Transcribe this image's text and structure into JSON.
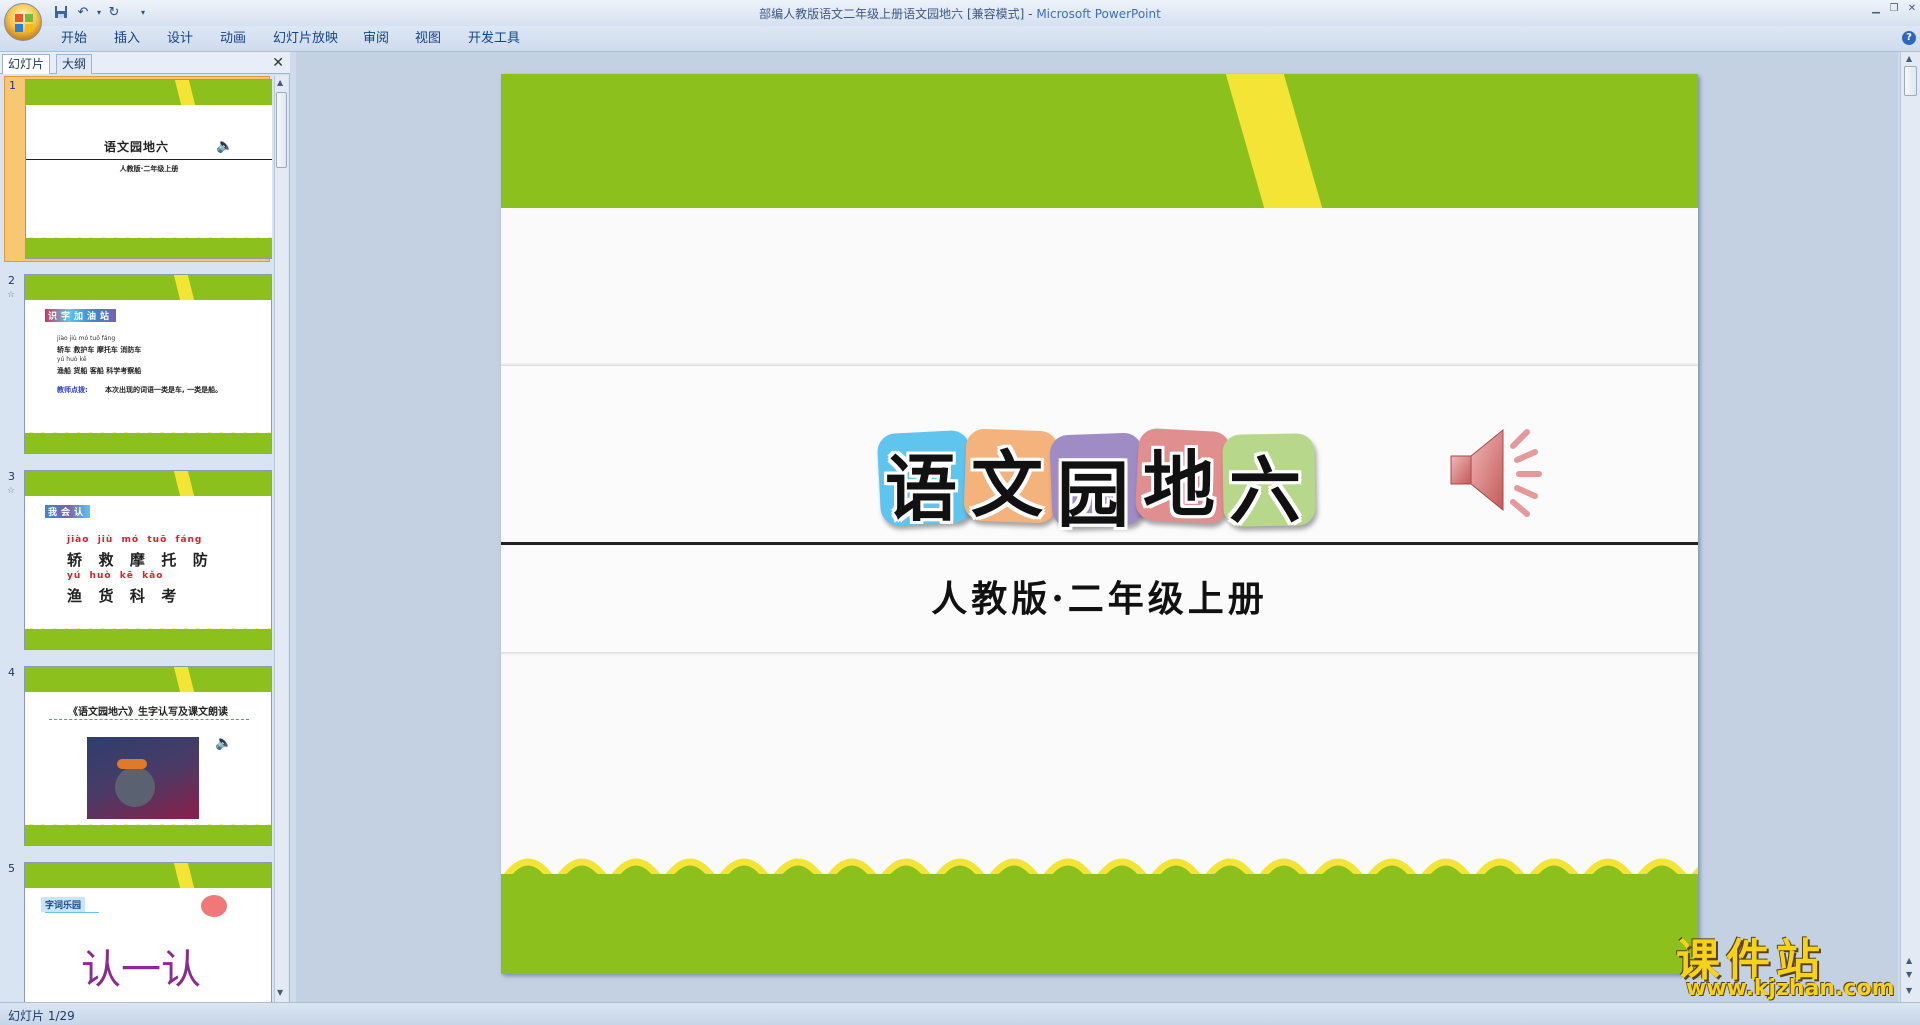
{
  "window": {
    "title_doc": "部编人教版语文二年级上册语文园地六 [兼容模式]",
    "title_sep": " - ",
    "title_app": "Microsoft PowerPoint"
  },
  "ribbon": {
    "tabs": [
      "开始",
      "插入",
      "设计",
      "动画",
      "幻灯片放映",
      "审阅",
      "视图",
      "开发工具"
    ]
  },
  "pane": {
    "tabs": [
      "幻灯片",
      "大纲"
    ],
    "thumbnails": [
      {
        "number": "1",
        "title": "语文园地六",
        "subtitle": "人教版·二年级上册"
      },
      {
        "number": "2",
        "heading": "识字加油站",
        "pinyin_row1": "jiào  jiù  mó tuō  fáng",
        "words_row1": "轿车  救护车  摩托车  消防车",
        "pinyin_row2": "yú  huò  kē",
        "words_row2": "渔船  货船  客船  科学考察船",
        "note_label": "教师点拨:",
        "note_text": "本次出现的词语一类是车, 一类是船。"
      },
      {
        "number": "3",
        "heading": "我会认",
        "pinyin_row1": "jiào  jiù  mó  tuō  fáng",
        "chars_row1": "轿  救  摩  托  防",
        "pinyin_row2": "yú  huò  kē  kǎo",
        "chars_row2": "渔  货  科  考"
      },
      {
        "number": "4",
        "heading": "《语文园地六》生字认写及课文朗读"
      },
      {
        "number": "5",
        "heading": "字词乐园",
        "big_text": "认一认"
      }
    ]
  },
  "slide": {
    "title_chars": [
      "语",
      "文",
      "园",
      "地",
      "六"
    ],
    "subtitle": "人教版·二年级上册"
  },
  "status": {
    "slide_counter": "幻灯片 1/29"
  },
  "watermark": {
    "title": "课件站",
    "url": "www.kjzhan.com"
  },
  "colors": {
    "slide_green": "#8cc11d",
    "slide_yellow": "#f4e436",
    "tile_colors": [
      "#5fc4ee",
      "#f4b27c",
      "#a08cc4",
      "#e08e8e",
      "#b7d88a"
    ]
  }
}
